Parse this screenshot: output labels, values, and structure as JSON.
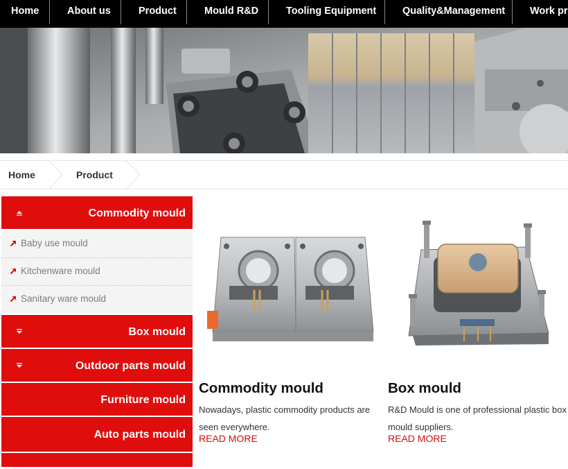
{
  "nav": {
    "items": [
      "Home",
      "About us",
      "Product",
      "Mould R&D",
      "Tooling Equipment",
      "Quality&Management",
      "Work pro"
    ]
  },
  "breadcrumb": {
    "items": [
      "Home",
      "Product"
    ]
  },
  "sidebar": {
    "categories": [
      {
        "label": "Commodity mould",
        "expanded": true,
        "subs": [
          "Baby use mould",
          "Kitchenware mould",
          "Sanitary ware mould"
        ]
      },
      {
        "label": "Box mould",
        "expanded": false
      },
      {
        "label": "Outdoor parts mould",
        "expanded": false
      },
      {
        "label": "Furniture mould"
      },
      {
        "label": "Auto parts mould"
      }
    ]
  },
  "products": [
    {
      "title": "Commodity mould",
      "desc_line1": "Nowadays, plastic commodity products are",
      "desc_line2": "seen everywhere.",
      "more": "READ MORE",
      "image_icon": "commodity-mould-image"
    },
    {
      "title": "Box mould",
      "desc_line1": "R&D Mould is one of professional plastic box",
      "desc_line2": "mould suppliers.",
      "more": "READ MORE",
      "image_icon": "box-mould-image"
    }
  ],
  "colors": {
    "nav_bg": "#000000",
    "accent_red": "#e00d0d",
    "link_red": "#d00f0f",
    "sub_bg": "#f4f4f4"
  }
}
